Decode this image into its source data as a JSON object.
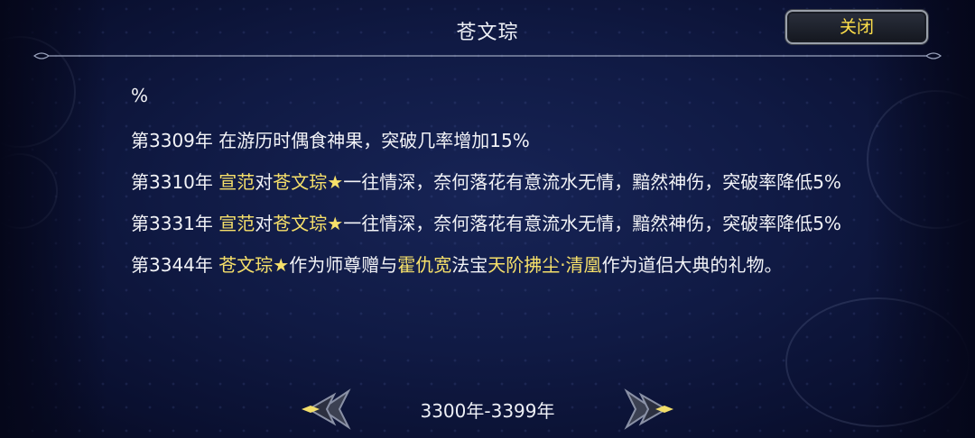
{
  "header": {
    "title": "苍文琮",
    "close_label": "关闭"
  },
  "content": {
    "fragment": "%",
    "entries": [
      {
        "year": "第3309年",
        "parts": [
          {
            "text": "在游历时偶食神果，突破几率增加15%",
            "highlight": false
          }
        ]
      },
      {
        "year": "第3310年",
        "parts": [
          {
            "text": "宣范",
            "highlight": true
          },
          {
            "text": "对",
            "highlight": false
          },
          {
            "text": "苍文琮★",
            "highlight": true
          },
          {
            "text": "一往情深，奈何落花有意流水无情，黯然神伤，突破率降低5%",
            "highlight": false
          }
        ]
      },
      {
        "year": "第3331年",
        "parts": [
          {
            "text": "宣范",
            "highlight": true
          },
          {
            "text": "对",
            "highlight": false
          },
          {
            "text": "苍文琮★",
            "highlight": true
          },
          {
            "text": "一往情深，奈何落花有意流水无情，黯然神伤，突破率降低5%",
            "highlight": false
          }
        ]
      },
      {
        "year": "第3344年",
        "parts": [
          {
            "text": "苍文琮★",
            "highlight": true
          },
          {
            "text": "作为师尊赠与",
            "highlight": false
          },
          {
            "text": "霍仇宽",
            "highlight": true
          },
          {
            "text": "法宝",
            "highlight": false
          },
          {
            "text": "天阶拂尘·清凰",
            "highlight": true
          },
          {
            "text": "作为道侣大典的礼物。",
            "highlight": false
          }
        ]
      }
    ]
  },
  "footer": {
    "range_label": "3300年-3399年"
  },
  "colors": {
    "highlight": "#f6e06a",
    "text": "#f2f3f7",
    "close_text": "#ffe04a",
    "background": "#101a44"
  },
  "icons": {
    "prev": "ornate-left-arrow-icon",
    "next": "ornate-right-arrow-icon"
  }
}
